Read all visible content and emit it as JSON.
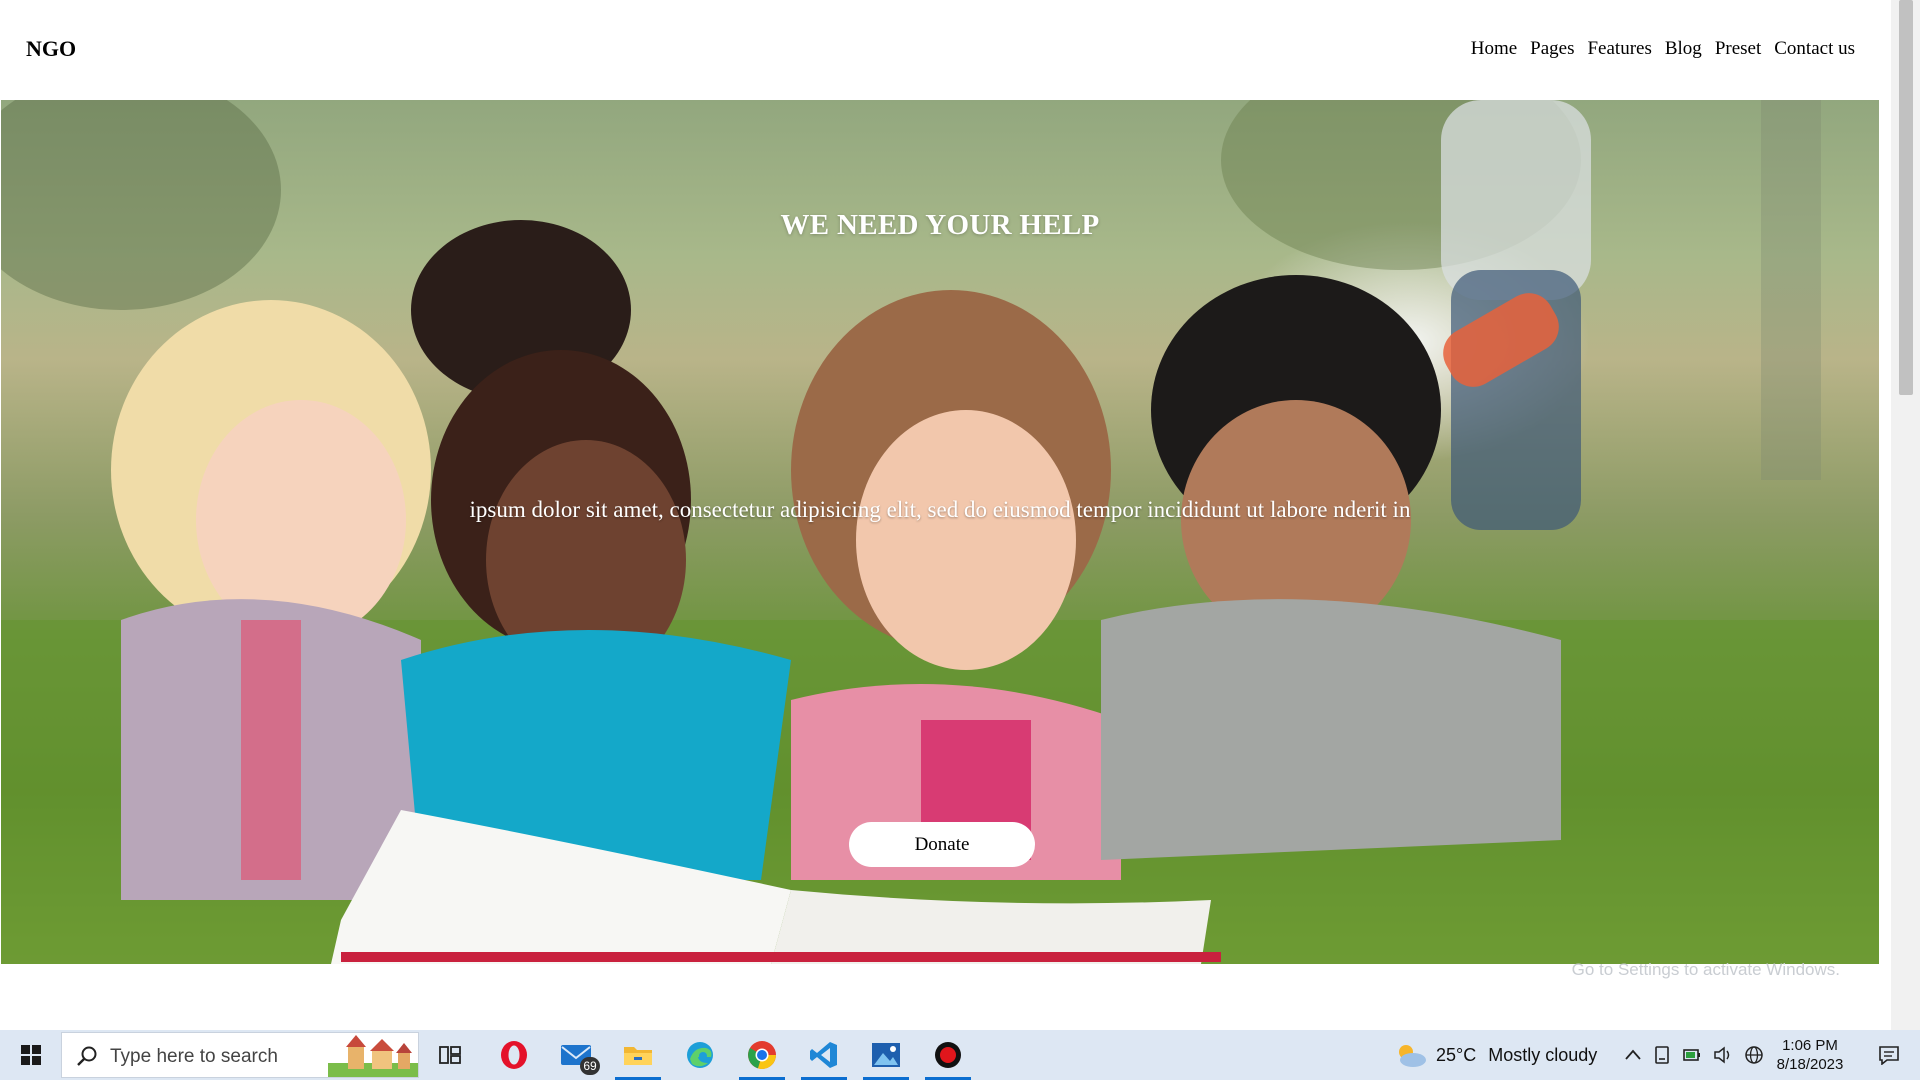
{
  "site": {
    "brand": "NGO",
    "nav": [
      "Home",
      "Pages",
      "Features",
      "Blog",
      "Preset",
      "Contact us"
    ]
  },
  "hero": {
    "title": "WE NEED YOUR HELP",
    "text": "ipsum dolor sit amet, consectetur adipisicing elit, sed do eiusmod tempor incididunt ut labore nderit in",
    "donate_label": "Donate",
    "photo_description_icon": "children-reading-photo"
  },
  "watermark": "Go to Settings to activate Windows.",
  "taskbar": {
    "search_placeholder": "Type here to search",
    "mail_badge": "69",
    "weather_temp": "25°C",
    "weather_text": "Mostly cloudy",
    "time": "1:06 PM",
    "date": "8/18/2023",
    "apps": [
      "task-view",
      "opera",
      "mail",
      "file-explorer",
      "edge",
      "chrome",
      "vscode",
      "photos",
      "recorder"
    ]
  },
  "colors": {
    "taskbar_bg": "#dde7f3",
    "accent": "#0b6ed0",
    "hero_grass": "#6f9540"
  }
}
